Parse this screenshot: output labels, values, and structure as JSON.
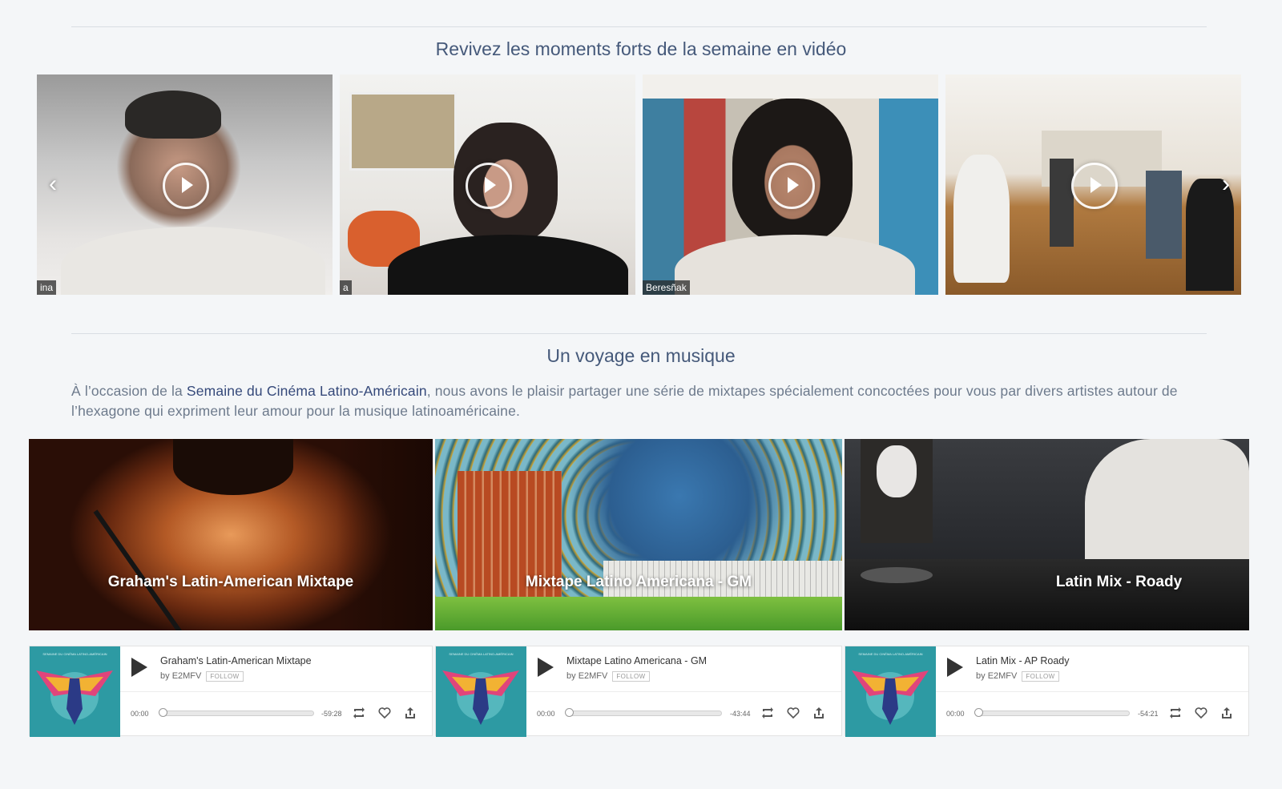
{
  "videos_section": {
    "title": "Revivez les moments forts de la semaine en vidéo",
    "prev_arrow": "‹",
    "next_arrow": "›",
    "videos": [
      {
        "name_tag": "ina"
      },
      {
        "name_tag": "a"
      },
      {
        "name_tag": "Beresñak"
      },
      {
        "name_tag": ""
      }
    ]
  },
  "music_section": {
    "title": "Un voyage en musique",
    "intro_before": "À l’occasion de la ",
    "intro_link": "Semaine du Cinéma Latino-Américain",
    "intro_after": ", nous avons le plaisir partager une série de mixtapes spécialement concoctées pour vous par divers artistes autour de l’hexagone qui expriment leur amour pour la musique latinoaméricaine.",
    "banners": [
      {
        "title": "Graham's Latin-American Mixtape"
      },
      {
        "title": "Mixtape Latino Americana - GM"
      },
      {
        "title": "Latin Mix - Roady"
      }
    ],
    "players": [
      {
        "cover_text": "SEMAINE DU CINÉMA LATINO-AMÉRICAIN",
        "title": "Graham's Latin-American Mixtape",
        "by": "by",
        "artist": "E2MFV",
        "follow": "FOLLOW",
        "time_start": "00:00",
        "time_remaining": "-59:28"
      },
      {
        "cover_text": "SEMAINE DU CINÉMA LATINO-AMÉRICAIN",
        "title": "Mixtape Latino Americana - GM",
        "by": "by",
        "artist": "E2MFV",
        "follow": "FOLLOW",
        "time_start": "00:00",
        "time_remaining": "-43:44"
      },
      {
        "cover_text": "SEMAINE DU CINÉMA LATINO-AMÉRICAIN",
        "title": "Latin Mix - AP Roady",
        "by": "by",
        "artist": "E2MFV",
        "follow": "FOLLOW",
        "time_start": "00:00",
        "time_remaining": "-54:21"
      }
    ],
    "player_icons": [
      "repeat-icon",
      "heart-icon",
      "share-icon"
    ]
  },
  "colors": {
    "background": "#f4f6f8",
    "heading": "#45597a",
    "link": "#35497a",
    "cover_teal": "#2d9aa3"
  }
}
